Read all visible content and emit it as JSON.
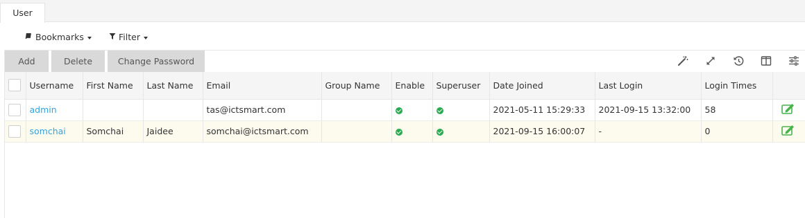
{
  "tab": {
    "label": "User"
  },
  "toolbar": {
    "bookmarks_label": "Bookmarks",
    "filter_label": "Filter"
  },
  "actions": {
    "add": "Add",
    "delete": "Delete",
    "change_password": "Change Password"
  },
  "right_icons": [
    "magic-wand-icon",
    "expand-icon",
    "history-icon",
    "columns-icon",
    "settings-sliders-icon"
  ],
  "table": {
    "headers": {
      "username": "Username",
      "first_name": "First Name",
      "last_name": "Last Name",
      "email": "Email",
      "group_name": "Group Name",
      "enable": "Enable",
      "superuser": "Superuser",
      "date_joined": "Date Joined",
      "last_login": "Last Login",
      "login_times": "Login Times"
    },
    "rows": [
      {
        "username": "admin",
        "first_name": "",
        "last_name": "",
        "email": "tas@ictsmart.com",
        "group_name": "",
        "enable": true,
        "superuser": true,
        "date_joined": "2021-05-11 15:29:33",
        "last_login": "2021-09-15 13:32:00",
        "login_times": "58"
      },
      {
        "username": "somchai",
        "first_name": "Somchai",
        "last_name": "Jaidee",
        "email": "somchai@ictsmart.com",
        "group_name": "",
        "enable": true,
        "superuser": true,
        "date_joined": "2021-09-15 16:00:07",
        "last_login": "-",
        "login_times": "0"
      }
    ]
  },
  "colors": {
    "link": "#33a3dc",
    "check_green": "#2bab51",
    "edit_green": "#47b34b",
    "button_gray": "#d9d9d9",
    "highlight_row": "#fdfbee"
  }
}
